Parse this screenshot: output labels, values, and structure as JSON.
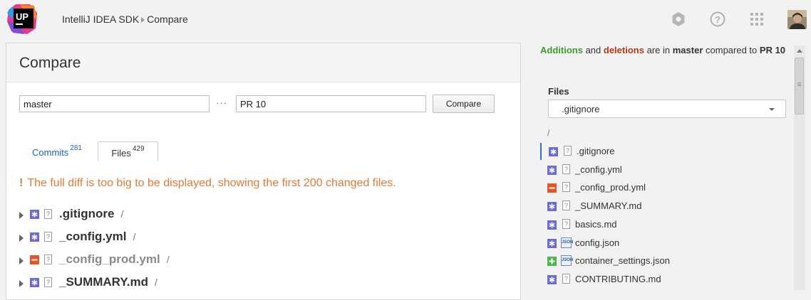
{
  "colors": {
    "added": "#6b6bd0",
    "removed": "#e8532a",
    "new": "#4fb548",
    "link": "#1e5fb4",
    "warning": "#e07b39"
  },
  "header": {
    "logo_text": "UP",
    "breadcrumb": [
      "IntelliJ IDEA SDK",
      "Compare"
    ],
    "icons": [
      "settings-icon",
      "help-icon",
      "apps-grid-icon",
      "user-avatar"
    ]
  },
  "main": {
    "title": "Compare",
    "source_branch": "master",
    "separator": "···",
    "target_branch": "PR 10",
    "compare_label": "Compare",
    "tabs": [
      {
        "label": "Commits",
        "count": "281",
        "selected": false
      },
      {
        "label": "Files",
        "count": "429",
        "selected": true
      }
    ],
    "warning_mark": "!",
    "warning_text": "The full diff is too big to be displayed, showing the first 200 changed files.",
    "files": [
      {
        "name": ".gitignore",
        "status": "modified",
        "path": "/"
      },
      {
        "name": "_config.yml",
        "status": "modified",
        "path": "/"
      },
      {
        "name": "_config_prod.yml",
        "status": "deleted",
        "path": "/"
      },
      {
        "name": "_SUMMARY.md",
        "status": "modified",
        "path": "/"
      }
    ]
  },
  "sidebar": {
    "summary": {
      "additions": "Additions",
      "and": "and",
      "deletions": "deletions",
      "are_in": "are in",
      "branch": "master",
      "compared_to": "compared to",
      "target": "PR 10"
    },
    "files_label": "Files",
    "select_value": ".gitignore",
    "root": "/",
    "files": [
      {
        "name": ".gitignore",
        "status": "modified",
        "type": "text",
        "active": true
      },
      {
        "name": "_config.yml",
        "status": "modified",
        "type": "text",
        "active": false
      },
      {
        "name": "_config_prod.yml",
        "status": "deleted",
        "type": "text",
        "active": false
      },
      {
        "name": "_SUMMARY.md",
        "status": "modified",
        "type": "text",
        "active": false
      },
      {
        "name": "basics.md",
        "status": "modified",
        "type": "text",
        "active": false
      },
      {
        "name": "config.json",
        "status": "modified",
        "type": "json",
        "active": false
      },
      {
        "name": "container_settings.json",
        "status": "added",
        "type": "json",
        "active": false
      },
      {
        "name": "CONTRIBUTING.md",
        "status": "modified",
        "type": "text",
        "active": false
      }
    ],
    "json_label": "JSON"
  }
}
